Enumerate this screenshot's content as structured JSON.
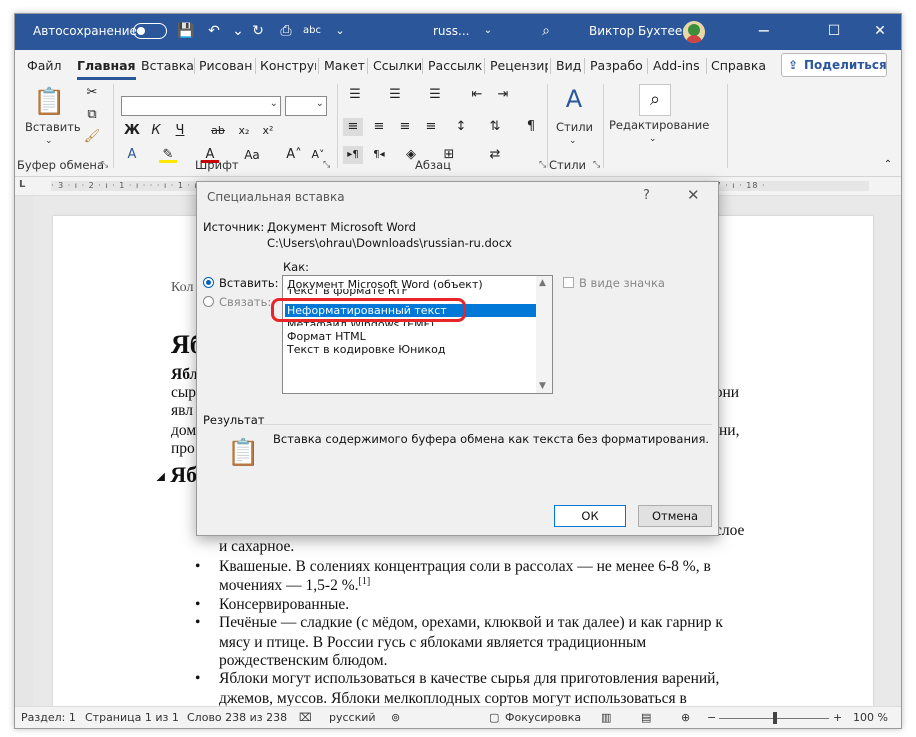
{
  "titlebar": {
    "autosave_label": "Автосохранение",
    "doc_name": "russ...",
    "user_name": "Виктор Бухтеев"
  },
  "tabs": [
    "Файл",
    "Главная",
    "Вставка",
    "Рисовани",
    "Конструк",
    "Макет",
    "Ссылки",
    "Рассылк",
    "Рецензир",
    "Вид",
    "Разрабо",
    "Add-ins",
    "Справка"
  ],
  "share_label": "Поделиться",
  "ribbon": {
    "paste_label": "Вставить",
    "clipboard_group": "Буфер обмена",
    "font_group": "Шрифт",
    "paragraph_group": "Абзац",
    "styles_label": "Стили",
    "styles_group": "Стили",
    "editing_label": "Редактирование",
    "font_buttons": {
      "bold": "Ж",
      "italic": "К",
      "underline": "Ч",
      "strike": "ab",
      "sub": "x₂",
      "sup": "x²",
      "case": "Aa",
      "grow": "A^",
      "shrink": "A˅",
      "clear": "A"
    }
  },
  "ruler_text": "· 3 · ı · 2 · ı · 1 · ı · · · ı · 1 · ı · 2 · ı · 3 · ı · 4 · ı · 5 · ı · 6 · ı · 7 · ı · 8 · ı · 9 · ı · 10 · ı · 11 · ı · 12 · ı · 13 · ı · 14 · ı · 15 · ı · 16 · ı · 17 · ı · 18 ·",
  "document": {
    "partial_lines": [
      "Кол",
      "Яб",
      "Ябло",
      "сыр",
      "явл",
      "дом",
      "про",
      "Ябл"
    ],
    "right_fragments": [
      "лони",
      "ни,",
      "слое"
    ],
    "lines": [
      "и сахарное.",
      "Квашеные. В солениях концентрация соли в рассолах — не менее 6-8 %, в",
      "мочениях — 1,5-2 %.",
      "[1]",
      "Консервированные.",
      "Печёные — сладкие (с мёдом, орехами, клюквой и так далее) и как гарнир к",
      "мясу и птице. В России гусь с яблоками является традиционным",
      "рождественским блюдом.",
      "Яблоки могут использоваться в качестве сырья для приготовления варений,",
      "джемов, муссов. Яблоки мелкоплодных сортов могут использоваться в"
    ]
  },
  "dialog": {
    "title": "Специальная вставка",
    "help": "?",
    "close": "✕",
    "source_label": "Источник:",
    "source_value": "Документ Microsoft Word",
    "source_path": "C:\\Users\\ohrau\\Downloads\\russian-ru.docx",
    "as_label": "Как:",
    "paste_option": "Вставить:",
    "link_option": "Связать:",
    "list_items": [
      "Документ Microsoft Word (объект)",
      "Текст в формате RTF",
      "Неформатированный текст",
      "Метафайл Windows (EMF)",
      "Формат HTML",
      "Текст в кодировке Юникод"
    ],
    "selected_index": 2,
    "icon_checkbox_label": "В виде значка",
    "result_label": "Результат",
    "result_text": "Вставка содержимого буфера обмена как текста без форматирования.",
    "ok_label": "ОК",
    "cancel_label": "Отмена"
  },
  "statusbar": {
    "section": "Раздел: 1",
    "page": "Страница 1 из 1",
    "words": "Слово 238 из 238",
    "language": "русский",
    "focus": "Фокусировка",
    "zoom": "100 %"
  },
  "colors": {
    "accent": "#2b579a",
    "selection": "#0078d7",
    "highlight_ring": "#e8262a"
  }
}
